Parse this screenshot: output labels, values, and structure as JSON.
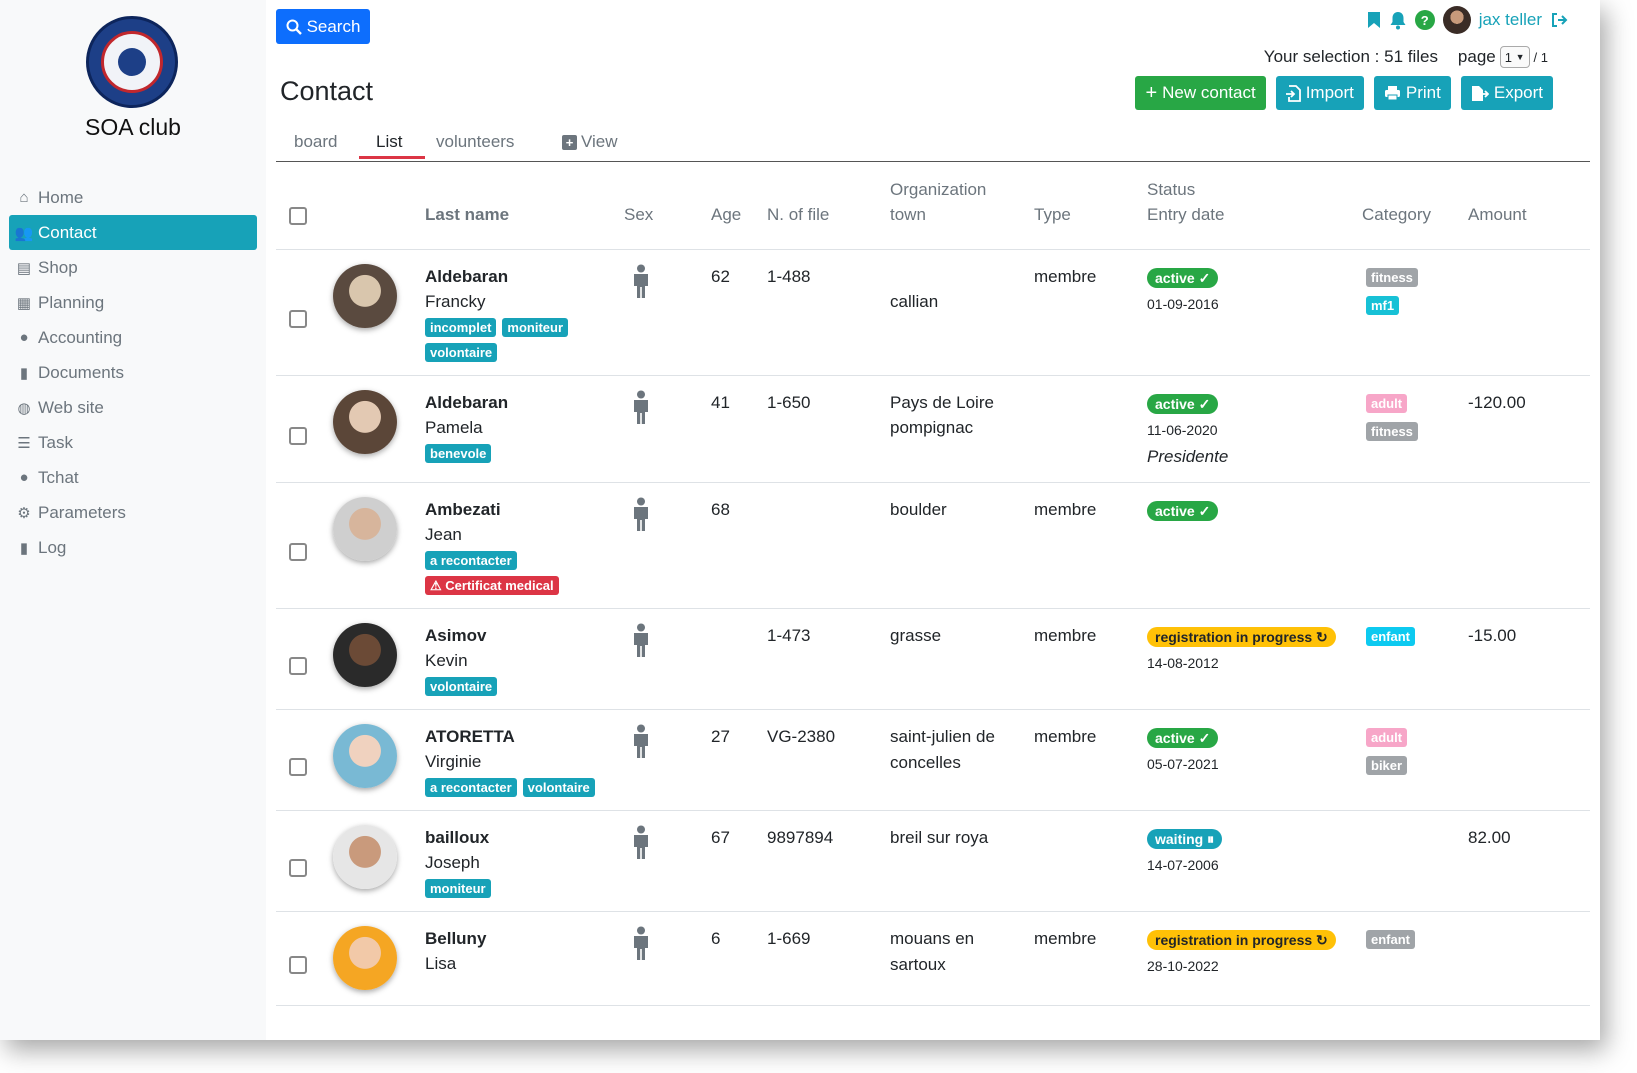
{
  "app": {
    "name": "SOA club"
  },
  "sidebar": {
    "items": [
      {
        "label": "Home",
        "icon": "home-icon",
        "glyph": "⌂"
      },
      {
        "label": "Contact",
        "icon": "users-icon",
        "glyph": "👥",
        "active": true
      },
      {
        "label": "Shop",
        "icon": "store-icon",
        "glyph": "▤"
      },
      {
        "label": "Planning",
        "icon": "calendar-icon",
        "glyph": "▦"
      },
      {
        "label": "Accounting",
        "icon": "piggy-bank-icon",
        "glyph": "●"
      },
      {
        "label": "Documents",
        "icon": "file-icon",
        "glyph": "▮"
      },
      {
        "label": "Web site",
        "icon": "globe-icon",
        "glyph": "◍"
      },
      {
        "label": "Task",
        "icon": "task-list-icon",
        "glyph": "☰"
      },
      {
        "label": "Tchat",
        "icon": "chat-icon",
        "glyph": "●"
      },
      {
        "label": "Parameters",
        "icon": "gear-icon",
        "glyph": "⚙"
      },
      {
        "label": "Log",
        "icon": "book-icon",
        "glyph": "▮"
      }
    ]
  },
  "topbar": {
    "search_label": "Search",
    "username": "jax teller",
    "help_glyph": "?"
  },
  "selection": {
    "text": "Your selection : 51 files"
  },
  "pager": {
    "label": "page",
    "current": "1",
    "total": "/ 1"
  },
  "page_title": "Contact",
  "actions": {
    "new_contact": "New contact",
    "import": "Import",
    "print": "Print",
    "export": "Export"
  },
  "tabs": {
    "board": "board",
    "list": "List",
    "volunteers": "volunteers",
    "view": "View"
  },
  "table": {
    "headers": {
      "last_name": "Last name",
      "sex": "Sex",
      "age": "Age",
      "file": "N. of file",
      "org1": "Organization",
      "org2": "town",
      "type": "Type",
      "status1": "Status",
      "status2": "Entry date",
      "category": "Category",
      "amount": "Amount"
    },
    "rows": [
      {
        "last": "Aldebaran",
        "first": "Francky",
        "tags": [
          {
            "t": "incomplet"
          },
          {
            "t": "moniteur"
          },
          {
            "t": "volontaire"
          }
        ],
        "age": "62",
        "file": "1-488",
        "org": "",
        "town": "callian",
        "type": "membre",
        "status": "active ✓",
        "status_kind": "green",
        "date": "01-09-2016",
        "role": "",
        "cats": [
          {
            "t": "fitness",
            "k": "grey"
          },
          {
            "t": "mf1",
            "k": "teal"
          }
        ],
        "amount": "",
        "photo": [
          "#d9c6ad",
          "#5a4a3f"
        ]
      },
      {
        "last": "Aldebaran",
        "first": "Pamela",
        "tags": [
          {
            "t": "benevole"
          }
        ],
        "age": "41",
        "file": "1-650",
        "org": "Pays de Loire",
        "town": "pompignac",
        "type": "",
        "status": "active ✓",
        "status_kind": "green",
        "date": "11-06-2020",
        "role": "Presidente",
        "cats": [
          {
            "t": "adult",
            "k": "pink"
          },
          {
            "t": "fitness",
            "k": "grey"
          }
        ],
        "amount": "-120.00",
        "photo": [
          "#e3c9b3",
          "#5b4638"
        ]
      },
      {
        "last": "Ambezati",
        "first": "Jean",
        "tags": [
          {
            "t": "a recontacter"
          },
          {
            "t": "⚠ Certificat medical",
            "k": "red"
          }
        ],
        "age": "68",
        "file": "",
        "org": "",
        "town": "boulder",
        "type": "membre",
        "status": "active ✓",
        "status_kind": "green",
        "date": "",
        "role": "",
        "cats": [],
        "amount": "",
        "photo": [
          "#d7b59c",
          "#cfcfcf"
        ]
      },
      {
        "last": "Asimov",
        "first": "Kevin",
        "tags": [
          {
            "t": "volontaire"
          }
        ],
        "age": "",
        "file": "1-473",
        "org": "",
        "town": "grasse",
        "type": "membre",
        "status": "registration in progress ↻",
        "status_kind": "yellow",
        "date": "14-08-2012",
        "role": "",
        "cats": [
          {
            "t": "enfant",
            "k": "cyan"
          }
        ],
        "amount": "-15.00",
        "photo": [
          "#6b4a36",
          "#2a2a2a"
        ]
      },
      {
        "last": "ATORETTA",
        "first": "Virginie",
        "tags": [
          {
            "t": "a recontacter"
          },
          {
            "t": "volontaire"
          }
        ],
        "age": "27",
        "file": "VG-2380",
        "org": "",
        "town": "saint-julien de concelles",
        "type": "membre",
        "status": "active ✓",
        "status_kind": "green",
        "date": "05-07-2021",
        "role": "",
        "cats": [
          {
            "t": "adult",
            "k": "pink"
          },
          {
            "t": "biker",
            "k": "grey"
          }
        ],
        "amount": "",
        "photo": [
          "#f0d2bf",
          "#79b9d4"
        ]
      },
      {
        "last": "bailloux",
        "first": "Joseph",
        "tags": [
          {
            "t": "moniteur"
          }
        ],
        "age": "67",
        "file": "9897894",
        "org": "",
        "town": "breil sur roya",
        "type": "",
        "status": "waiting ⏸",
        "status_kind": "teal",
        "date": "14-07-2006",
        "role": "",
        "cats": [],
        "amount": "82.00",
        "photo": [
          "#c99a7c",
          "#e6e6e6"
        ]
      },
      {
        "last": "Belluny",
        "first": "Lisa",
        "tags": [],
        "age": "6",
        "file": "1-669",
        "org": "",
        "town": "mouans en sartoux",
        "type": "membre",
        "status": "registration in progress ↻",
        "status_kind": "yellow",
        "date": "28-10-2022",
        "role": "",
        "cats": [
          {
            "t": "enfant",
            "k": "grey"
          }
        ],
        "amount": "",
        "photo": [
          "#f2c9a8",
          "#f5a623"
        ]
      }
    ]
  },
  "colors": {
    "accent": "#17a2b8",
    "primary": "#0d6efd",
    "success": "#28a745",
    "warning": "#ffc107",
    "danger": "#dc3545"
  }
}
